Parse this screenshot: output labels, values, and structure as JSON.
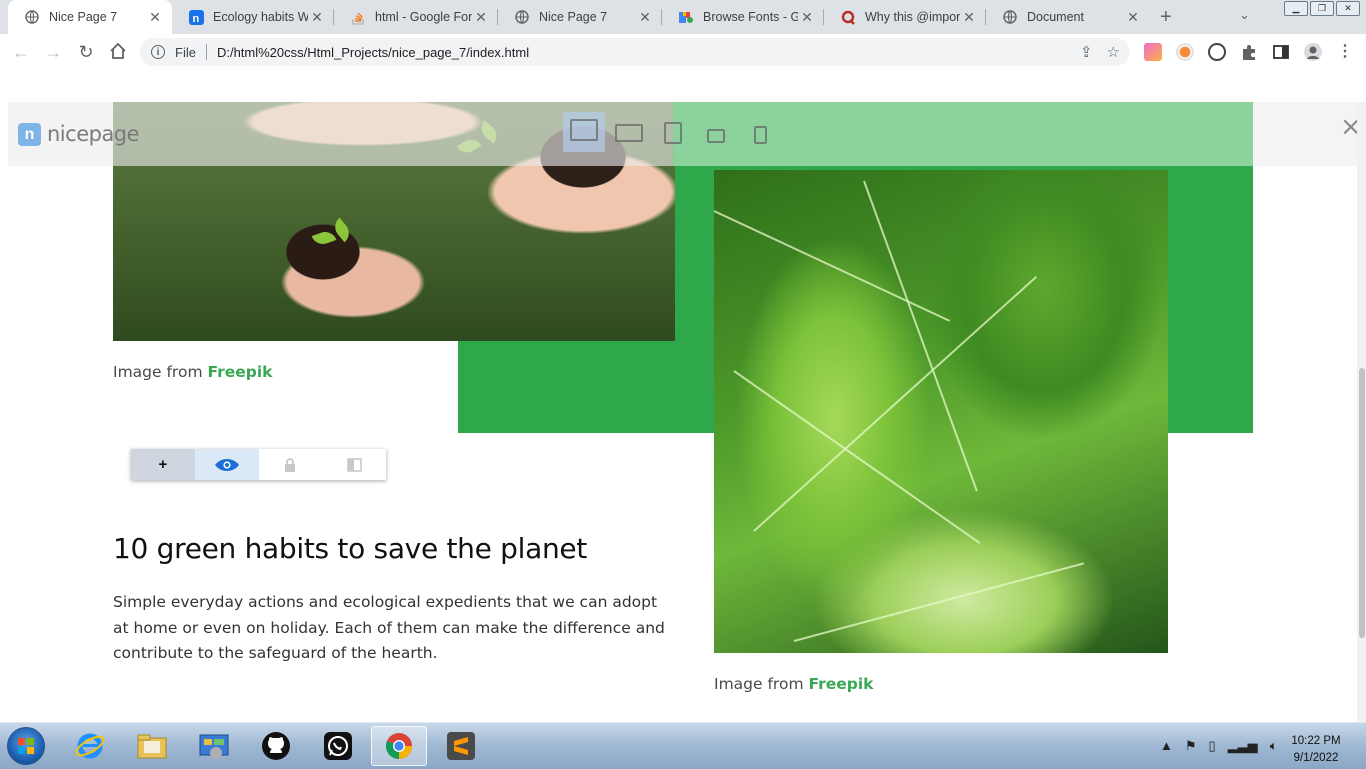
{
  "browser": {
    "tabs": [
      {
        "title": "Nice Page 7",
        "favicon": "globe-icon",
        "active": true
      },
      {
        "title": "Ecology habits We",
        "favicon": "nicepage-icon",
        "active": false
      },
      {
        "title": "html - Google Fon",
        "favicon": "stackoverflow-icon",
        "active": false
      },
      {
        "title": "Nice Page 7",
        "favicon": "globe-icon",
        "active": false
      },
      {
        "title": "Browse Fonts - Go",
        "favicon": "google-fonts-icon",
        "active": false
      },
      {
        "title": "Why this @import",
        "favicon": "quora-icon",
        "active": false
      },
      {
        "title": "Document",
        "favicon": "globe-icon",
        "active": false
      }
    ],
    "new_tab": "+",
    "address": {
      "scheme_label": "File",
      "url": "D:/html%20css/Html_Projects/nice_page_7/index.html"
    }
  },
  "nicepage": {
    "logo_text": "nicepage",
    "device_buttons": [
      "desktop-icon",
      "laptop-icon",
      "tablet-portrait-icon",
      "tablet-landscape-icon",
      "phone-icon"
    ],
    "close": "×"
  },
  "content": {
    "caption1_prefix": "Image from",
    "caption1_link": "Freepik",
    "caption2_prefix": "Image from",
    "caption2_link": "Freepik",
    "headline": "10 green habits to save the planet",
    "body": "Simple everyday actions and ecological expedients that we can adopt at home or even on holiday. Each of them can make the difference and contribute to the safeguard of the hearth.",
    "mini_toolbar": {
      "add": "+"
    }
  },
  "taskbar": {
    "apps": [
      "internet-explorer-icon",
      "file-explorer-icon",
      "control-panel-icon",
      "github-icon",
      "whatsapp-icon",
      "chrome-icon",
      "sublime-text-icon"
    ],
    "time": "10:22 PM",
    "date": "9/1/2022"
  },
  "colors": {
    "accent_green": "#2ea84a",
    "link_green": "#3aa755"
  }
}
